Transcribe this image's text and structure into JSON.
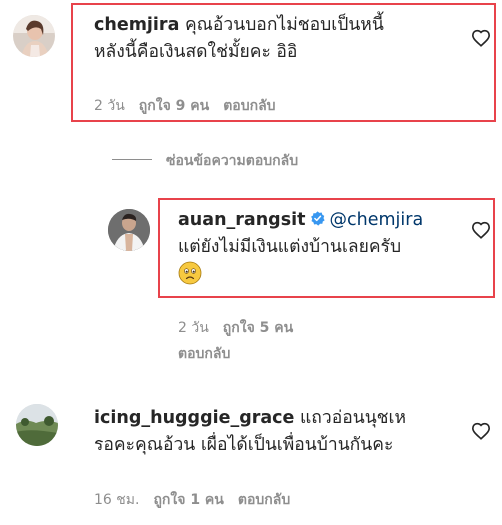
{
  "comments": [
    {
      "username": "chemjira",
      "text_line1": "คุณอ้วนบอกไม่ชอบเป็นหนี้",
      "text_line2": "หลังนี้คือเงินสดใช่มั้ยคะ อิอิ",
      "time": "2 วัน",
      "likes": "ถูกใจ 9 คน",
      "reply": "ตอบกลับ"
    },
    {
      "username": "icing_hugggie_grace",
      "text_line1": "แถวอ่อนนุชเห",
      "text_line2": "รอคะคุณอ้วน เผื่อได้เป็นเพื่อนบ้านกันคะ",
      "time": "16 ชม.",
      "likes": "ถูกใจ 1 คน",
      "reply": "ตอบกลับ"
    }
  ],
  "hide_replies_label": "ซ่อนข้อความตอบกลับ",
  "reply": {
    "username": "auan_rangsit",
    "mention": "@chemjira",
    "text": "แต่ยังไม่มีเงินแต่งบ้านเลยครับ",
    "emoji": "🙁",
    "time": "2 วัน",
    "likes": "ถูกใจ 5 คน",
    "reply": "ตอบกลับ"
  },
  "colors": {
    "highlight": "#e8434b",
    "verified": "#3897f0",
    "mention": "#00376b",
    "meta": "#8e8e8e"
  },
  "icons": [
    "heart-icon",
    "verified-badge-icon",
    "frowning-face-emoji"
  ]
}
